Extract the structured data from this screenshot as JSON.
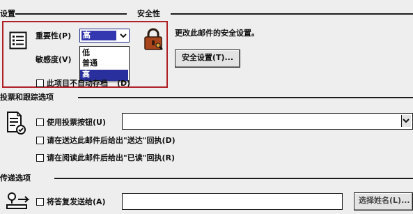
{
  "settings": {
    "section_title": "设置",
    "importance_label": "重要性(P)",
    "sensitivity_label": "敏感度(V)",
    "importance_value": "高",
    "importance_options": [
      "低",
      "普通",
      "高"
    ],
    "no_autoarchive_label": "此项目不自动存档",
    "no_autoarchive_suffix": "(D)"
  },
  "security": {
    "section_title": "安全性",
    "description": "更改此邮件的安全设置。",
    "settings_button": "安全设置(T)..."
  },
  "voting": {
    "section_title": "投票和跟踪选项",
    "use_voting_buttons": "使用投票按钮(U)",
    "delivery_receipt": "请在送达此邮件后给出\"送达\"回执(D)",
    "read_receipt": "请在阅读此邮件后给出\"已读\"回执(R)"
  },
  "delivery": {
    "section_title": "传递选项",
    "have_replies_sent": "将答复发送给(A)",
    "select_names_button": "选择姓名(L)..."
  },
  "colors": {
    "highlight": "#b02027",
    "selection": "#2a2f9e"
  }
}
